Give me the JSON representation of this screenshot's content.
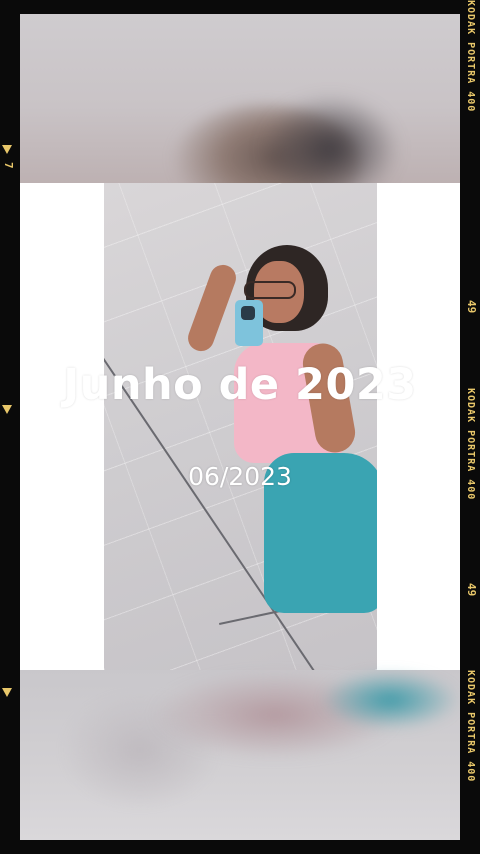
{
  "overlay": {
    "title": "Junho de 2023",
    "date": "06/2023"
  },
  "film_border": {
    "brand_label": "KODAK PORTRA 400",
    "frame_number": "49",
    "left_marker": "7",
    "accent_color": "#e8c76a"
  }
}
